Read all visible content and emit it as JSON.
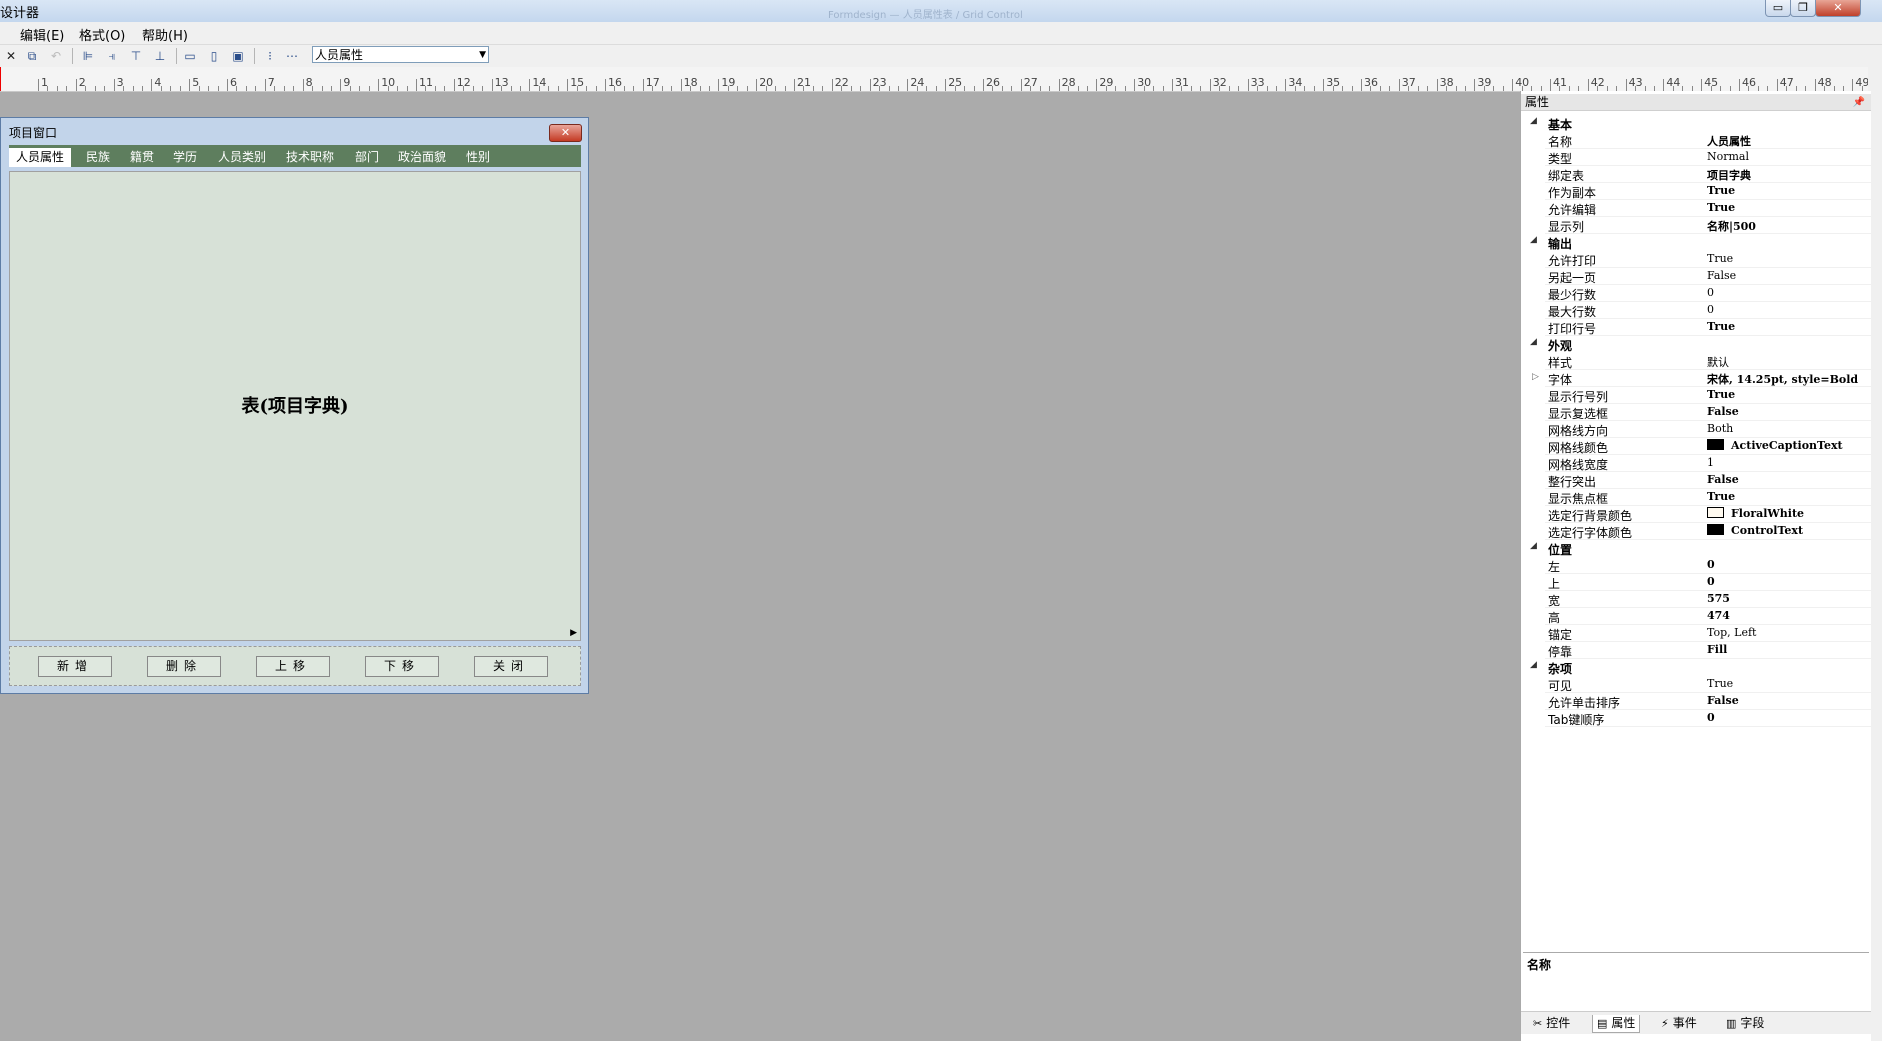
{
  "window": {
    "title": "设计器",
    "title_faded": "Formdesign  —  人员属性表 / Grid Control",
    "controls": {
      "minimize": "▭",
      "restore": "❐",
      "close": "✕"
    }
  },
  "menu": {
    "items": [
      "编辑(E)",
      "格式(O)",
      "帮助(H)"
    ]
  },
  "toolbar": {
    "icons": [
      "delete-icon",
      "copy-icon",
      "undo-icon",
      "align-left-icon",
      "align-right-icon",
      "align-top-icon",
      "align-bottom-icon",
      "same-width-icon",
      "same-height-icon",
      "same-size-icon",
      "vertical-spacing-icon",
      "horizontal-spacing-icon"
    ],
    "combo_value": "人员属性"
  },
  "ruler": {
    "labels": [
      "1",
      "2",
      "3",
      "4",
      "5",
      "6",
      "7",
      "8",
      "9",
      "10",
      "11",
      "12",
      "13",
      "14",
      "15",
      "16",
      "17",
      "18",
      "19",
      "20",
      "21",
      "22",
      "23",
      "24",
      "25",
      "26",
      "27",
      "28",
      "29",
      "30",
      "31",
      "32",
      "33",
      "34",
      "35",
      "36",
      "37",
      "38",
      "39",
      "40",
      "41",
      "42",
      "43",
      "44",
      "45",
      "46",
      "47",
      "48",
      "49"
    ]
  },
  "project_window": {
    "title": "项目窗口",
    "close": "✕",
    "tabs": [
      "人员属性",
      "民族",
      "籍贯",
      "学历",
      "人员类别",
      "技术职称",
      "部门",
      "政治面貌",
      "性别"
    ],
    "active_tab": 0,
    "grid_caption": "表(项目字典)",
    "buttons": [
      "新增",
      "删除",
      "上移",
      "下移",
      "关闭"
    ]
  },
  "properties": {
    "header": "属性",
    "pin": "ᵖ",
    "categories": [
      {
        "name": "基本",
        "rows": [
          {
            "name": "名称",
            "value": "人员属性",
            "bold": true
          },
          {
            "name": "类型",
            "value": "Normal",
            "bold": false
          },
          {
            "name": "绑定表",
            "value": "项目字典",
            "bold": true
          },
          {
            "name": "作为副本",
            "value": "True",
            "bold": true
          },
          {
            "name": "允许编辑",
            "value": "True",
            "bold": true
          },
          {
            "name": "显示列",
            "value": "名称|500",
            "bold": true
          }
        ]
      },
      {
        "name": "输出",
        "rows": [
          {
            "name": "允许打印",
            "value": "True",
            "bold": false
          },
          {
            "name": "另起一页",
            "value": "False",
            "bold": false
          },
          {
            "name": "最少行数",
            "value": "0",
            "bold": false
          },
          {
            "name": "最大行数",
            "value": "0",
            "bold": false
          },
          {
            "name": "打印行号",
            "value": "True",
            "bold": true
          }
        ]
      },
      {
        "name": "外观",
        "rows": [
          {
            "name": "样式",
            "value": "默认",
            "bold": false
          },
          {
            "name": "字体",
            "value": "宋体, 14.25pt, style=Bold",
            "bold": true,
            "expandable": true
          },
          {
            "name": "显示行号列",
            "value": "True",
            "bold": true
          },
          {
            "name": "显示复选框",
            "value": "False",
            "bold": true
          },
          {
            "name": "网格线方向",
            "value": "Both",
            "bold": false
          },
          {
            "name": "网格线颜色",
            "value": "ActiveCaptionText",
            "bold": true,
            "swatch": "#000000"
          },
          {
            "name": "网格线宽度",
            "value": "1",
            "bold": false
          },
          {
            "name": "整行突出",
            "value": "False",
            "bold": true
          },
          {
            "name": "显示焦点框",
            "value": "True",
            "bold": true
          },
          {
            "name": "选定行背景颜色",
            "value": "FloralWhite",
            "bold": true,
            "swatch": "#fffaf0"
          },
          {
            "name": "选定行字体颜色",
            "value": "ControlText",
            "bold": true,
            "swatch": "#000000"
          }
        ]
      },
      {
        "name": "位置",
        "rows": [
          {
            "name": "左",
            "value": "0",
            "bold": true
          },
          {
            "name": "上",
            "value": "0",
            "bold": true
          },
          {
            "name": "宽",
            "value": "575",
            "bold": true
          },
          {
            "name": "高",
            "value": "474",
            "bold": true
          },
          {
            "name": "锚定",
            "value": "Top, Left",
            "bold": false
          },
          {
            "name": "停靠",
            "value": "Fill",
            "bold": true
          }
        ]
      },
      {
        "name": "杂项",
        "rows": [
          {
            "name": "可见",
            "value": "True",
            "bold": false
          },
          {
            "name": "允许单击排序",
            "value": "False",
            "bold": true
          },
          {
            "name": "Tab键顺序",
            "value": "0",
            "bold": true
          }
        ]
      }
    ],
    "description_title": "名称",
    "bottom_tabs": [
      {
        "label": "控件",
        "icon": "tools-icon",
        "glyph": "✂",
        "active": false
      },
      {
        "label": "属性",
        "icon": "properties-icon",
        "glyph": "▤",
        "active": true
      },
      {
        "label": "事件",
        "icon": "lightning-icon",
        "glyph": "⚡",
        "active": false
      },
      {
        "label": "字段",
        "icon": "field-icon",
        "glyph": "▥",
        "active": false
      }
    ]
  },
  "colors": {
    "tab_strip": "#5e7e5e",
    "grid_background": "#d7e1d7",
    "workspace": "#ababab"
  }
}
